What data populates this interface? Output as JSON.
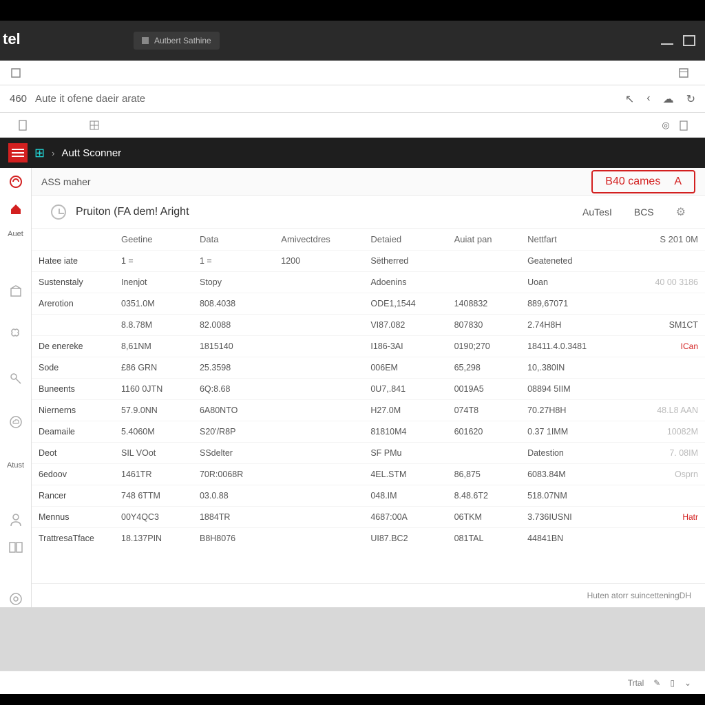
{
  "brand": "tel",
  "tab_chip": "Autbert Sathine",
  "toolbar": {
    "path_num": "460",
    "path_text": "Aute it ofene daeir arate"
  },
  "app_header": {
    "title": "Autt Sconner"
  },
  "sub_header": {
    "title": "ASS maher",
    "badge": "B40 cames",
    "badge_suffix": "A"
  },
  "panel": {
    "title": "Pruiton (FA dem! Aright",
    "tabs": [
      "AuTesI",
      "BCS"
    ]
  },
  "left_rail": {
    "label1": "Auet",
    "label2": "Atust"
  },
  "table": {
    "headers": [
      "",
      "Geetine",
      "Data",
      "Amivectdres",
      "Detaied",
      "Auiat pan",
      "Nettfart",
      ""
    ],
    "meta_row1": [
      "Hatee iate",
      "1 =",
      "",
      "1 =",
      "1200",
      "Sëtherred",
      "",
      "Geateneted",
      ""
    ],
    "meta_row2": [
      "Sustenstaly",
      "Inenjot",
      "Stopy",
      "",
      "",
      "Adoenins",
      "",
      "Uoan",
      "40 00 3186"
    ],
    "meta_badge": "S 201 0M",
    "rows": [
      {
        "name": "Arerotion",
        "c1": "0351.0M",
        "c2": "808.4038",
        "c3": "ODE1,1544",
        "c4": "1408832",
        "c5": "889,67071",
        "c6": ""
      },
      {
        "name": "",
        "c1": "8.8.78M",
        "c2": "82.0088",
        "c3": "VI87.082",
        "c4": "807830",
        "c5": "2.74H8H",
        "c6": "SM1CT"
      },
      {
        "name": "De enereke",
        "c1": "8,61NM",
        "c2": "1815140",
        "c3": "I186-3AI",
        "c4": "0190;270",
        "c5": "18411.4.0.3481",
        "c6": "ICan",
        "action": true
      },
      {
        "name": "Sode",
        "c1": "£86 GRN",
        "c2": "25.3598",
        "c3": "006EM",
        "c4": "65,298",
        "c5": "10,.380IN",
        "c6": ""
      },
      {
        "name": "Buneents",
        "c1": "1160 0JTN",
        "c2": "6Q:8.68",
        "c3": "0U7,.841",
        "c4": "0019A5",
        "c5": "08894 5IIM",
        "c6": ""
      },
      {
        "name": "Niernerns",
        "c1": "57.9.0NN",
        "c2": "6A80NTO",
        "c3": "H27.0M",
        "c4": "074T8",
        "c5": "70.27H8H",
        "c6": "48.L8 AAN",
        "muted": true
      },
      {
        "name": "Deamaile",
        "c1": "5.4060M",
        "c2": "S20'/R8P",
        "c3": "81810M4",
        "c4": "601620",
        "c5": "0.37 1IMM",
        "c6": "10082M",
        "muted": true
      },
      {
        "name": "Deot",
        "c1": "SIL VOot",
        "c2": "SSdelter",
        "c3": "SF PMu",
        "c4": "",
        "c5": "Datestion",
        "c6": "7. 08IM",
        "muted": true
      },
      {
        "name": "6edoov",
        "c1": "1461TR",
        "c2": "70R:0068R",
        "c3": "4EL.STM",
        "c4": "86,875",
        "c5": "6083.84M",
        "c6": "Osprn",
        "muted": true
      },
      {
        "name": "Rancer",
        "c1": "748 6TTM",
        "c2": "03.0.88",
        "c3": "048.IM",
        "c4": "8.48.6T2",
        "c5": "518.07NM",
        "c6": ""
      },
      {
        "name": "Mennus",
        "c1": "00Y4QC3",
        "c2": "1884TR",
        "c3": "4687:00A",
        "c4": "06TKM",
        "c5": "3.736IUSNI",
        "c6": "Hatr",
        "action": true
      },
      {
        "name": "TrattresaTface",
        "c1": "18.137PIN",
        "c2": "B8H8076",
        "c3": "UI87.BC2",
        "c4": "081TAL",
        "c5": "44841BN",
        "c6": ""
      }
    ],
    "footer_note": "Huten atorr suincetteningDH"
  },
  "status_bar": {
    "label": "Trtal"
  }
}
